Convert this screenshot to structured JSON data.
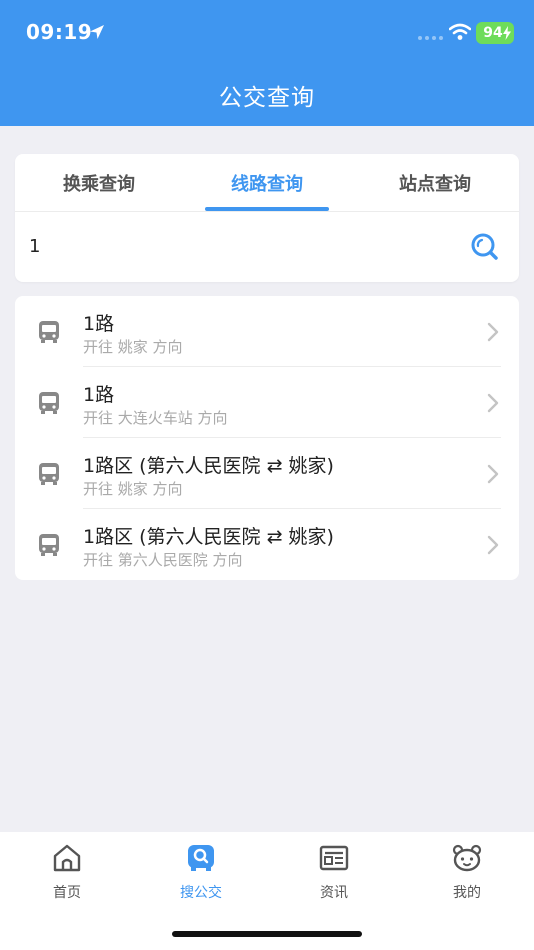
{
  "status_bar": {
    "time": "09:19",
    "battery": "94"
  },
  "header": {
    "title": "公交查询"
  },
  "search_tabs": [
    "换乘查询",
    "线路查询",
    "站点查询"
  ],
  "search": {
    "value": "1"
  },
  "results": [
    {
      "name": "1路",
      "direction": "开往 姚家 方向"
    },
    {
      "name": "1路",
      "direction": "开往 大连火车站 方向"
    },
    {
      "name": "1路区 (第六人民医院 ⇄ 姚家)",
      "direction": "开往 姚家 方向"
    },
    {
      "name": "1路区 (第六人民医院 ⇄ 姚家)",
      "direction": "开往 第六人民医院 方向"
    }
  ],
  "tabbar": [
    "首页",
    "搜公交",
    "资讯",
    "我的"
  ],
  "colors": {
    "accent": "#3f96f0",
    "battery": "#6edc5a"
  }
}
